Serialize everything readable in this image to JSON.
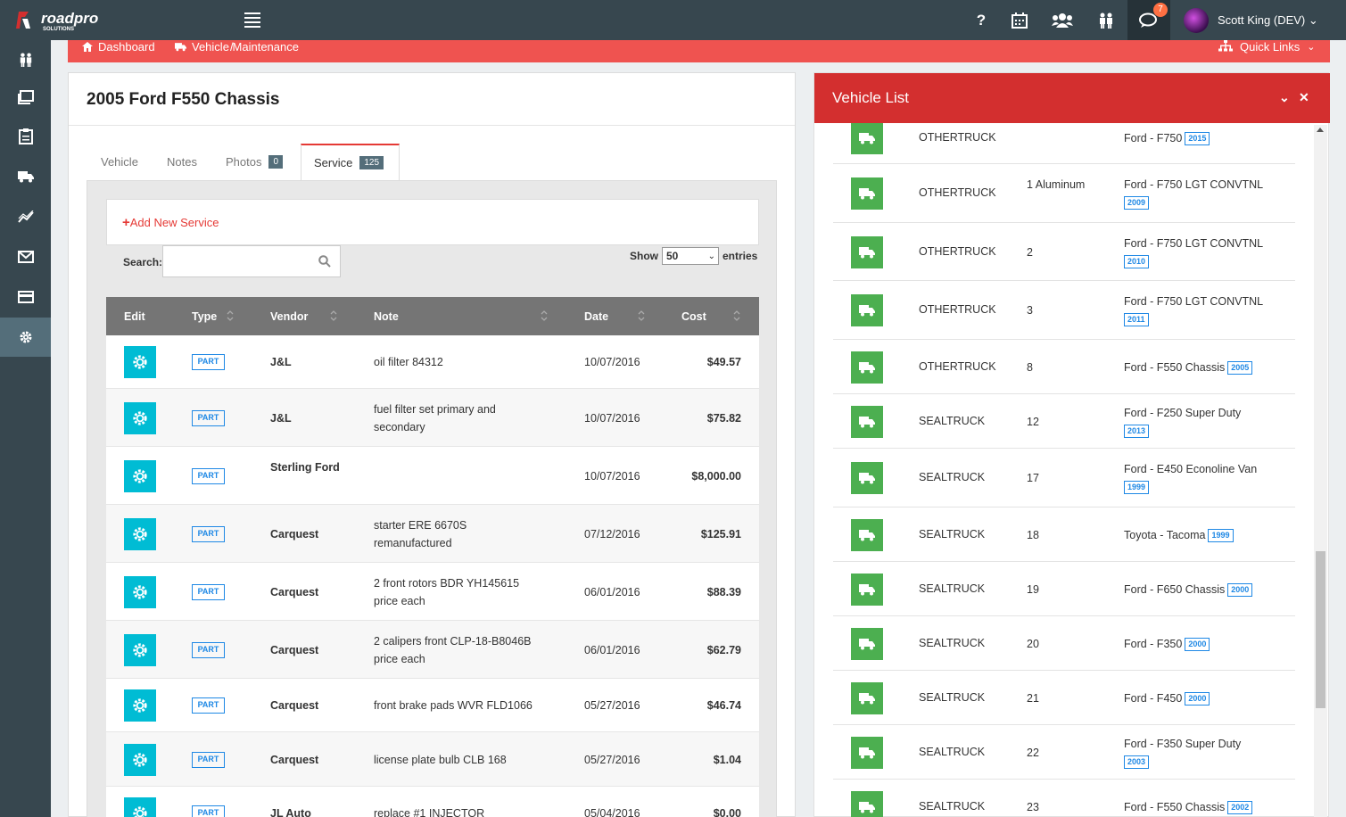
{
  "app": {
    "logo_text": "roadpro",
    "logo_sub": "SOLUTIONS"
  },
  "topbar": {
    "icons": [
      "help-icon",
      "calendar-icon",
      "users-group-icon",
      "people-icon",
      "chat-icon"
    ],
    "help_glyph": "?",
    "chat_badge": "7",
    "user_name": "Scott King (DEV)"
  },
  "sidebar": {
    "items": [
      "people-icon",
      "books-icon",
      "clipboard-icon",
      "truck-icon",
      "chart-icon",
      "mail-icon",
      "card-icon",
      "settings-icon"
    ],
    "active": "settings-icon"
  },
  "breadcrumb": {
    "items": [
      "Dashboard",
      "Vehicle Maintenance"
    ],
    "separator": "/",
    "quick_links": "Quick Links"
  },
  "panel": {
    "title": "2005 Ford F550 Chassis",
    "tabs": [
      {
        "label": "Vehicle",
        "count": ""
      },
      {
        "label": "Notes",
        "count": ""
      },
      {
        "label": "Photos",
        "count": "0"
      },
      {
        "label": "Service",
        "count": "125"
      }
    ],
    "active_tab": "Service",
    "add_service": "Add New Service",
    "search_label": "Search:",
    "search_value": "",
    "show_label": "Show",
    "entries_value": "50",
    "entries_label": "entries"
  },
  "service_table": {
    "columns": [
      "Edit",
      "Type",
      "Vendor",
      "Note",
      "Date",
      "Cost"
    ],
    "rows": [
      {
        "type": "PART",
        "vendor": "J&L",
        "note": "oil filter 84312",
        "date": "10/07/2016",
        "cost": "$49.57"
      },
      {
        "type": "PART",
        "vendor": "J&L",
        "note": "fuel filter set primary and secondary",
        "date": "10/07/2016",
        "cost": "$75.82"
      },
      {
        "type": "PART",
        "vendor": "Sterling Ford",
        "note": "",
        "date": "10/07/2016",
        "cost": "$8,000.00"
      },
      {
        "type": "PART",
        "vendor": "Carquest",
        "note": "starter ERE 6670S remanufactured",
        "date": "07/12/2016",
        "cost": "$125.91"
      },
      {
        "type": "PART",
        "vendor": "Carquest",
        "note": "2 front rotors BDR YH145615 price each",
        "date": "06/01/2016",
        "cost": "$88.39"
      },
      {
        "type": "PART",
        "vendor": "Carquest",
        "note": "2 calipers front CLP-18-B8046B price each",
        "date": "06/01/2016",
        "cost": "$62.79"
      },
      {
        "type": "PART",
        "vendor": "Carquest",
        "note": "front brake pads WVR FLD1066",
        "date": "05/27/2016",
        "cost": "$46.74"
      },
      {
        "type": "PART",
        "vendor": "Carquest",
        "note": "license plate bulb CLB 168",
        "date": "05/27/2016",
        "cost": "$1.04"
      },
      {
        "type": "PART",
        "vendor": "JL Auto",
        "note": "replace #1 INJECTOR",
        "date": "05/04/2016",
        "cost": "$0.00"
      }
    ]
  },
  "vehicle_list": {
    "title": "Vehicle List",
    "rows": [
      {
        "type": "OTHERTRUCK",
        "number": "",
        "model": "Ford - F750",
        "year": "2015"
      },
      {
        "type": "OTHERTRUCK",
        "number": "1 Aluminum",
        "model": "Ford - F750 LGT CONVTNL",
        "year": "2009"
      },
      {
        "type": "OTHERTRUCK",
        "number": "2",
        "model": "Ford - F750 LGT CONVTNL",
        "year": "2010"
      },
      {
        "type": "OTHERTRUCK",
        "number": "3",
        "model": "Ford - F750 LGT CONVTNL",
        "year": "2011"
      },
      {
        "type": "OTHERTRUCK",
        "number": "8",
        "model": "Ford - F550 Chassis",
        "year": "2005"
      },
      {
        "type": "SEALTRUCK",
        "number": "12",
        "model": "Ford - F250 Super Duty",
        "year": "2013"
      },
      {
        "type": "SEALTRUCK",
        "number": "17",
        "model": "Ford - E450 Econoline Van",
        "year": "1999"
      },
      {
        "type": "SEALTRUCK",
        "number": "18",
        "model": "Toyota - Tacoma",
        "year": "1999"
      },
      {
        "type": "SEALTRUCK",
        "number": "19",
        "model": "Ford - F650 Chassis",
        "year": "2000"
      },
      {
        "type": "SEALTRUCK",
        "number": "20",
        "model": "Ford - F350",
        "year": "2000"
      },
      {
        "type": "SEALTRUCK",
        "number": "21",
        "model": "Ford - F450",
        "year": "2000"
      },
      {
        "type": "SEALTRUCK",
        "number": "22",
        "model": "Ford - F350 Super Duty",
        "year": "2003"
      },
      {
        "type": "SEALTRUCK",
        "number": "23",
        "model": "Ford - F550 Chassis",
        "year": "2002"
      }
    ]
  },
  "colors": {
    "topbar": "#37474f",
    "accent_red": "#d32f2f",
    "breadcrumb_red": "#ef5350",
    "edit_cyan": "#00bcd4",
    "truck_green": "#4caf50",
    "badge_blue": "#1e88e5"
  }
}
